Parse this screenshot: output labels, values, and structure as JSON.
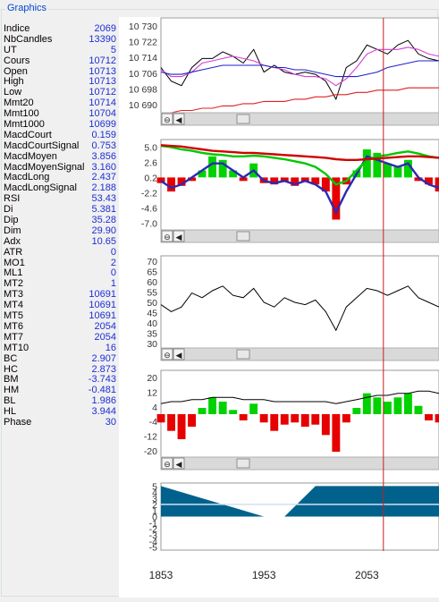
{
  "group_title": "Graphics",
  "indicators": [
    {
      "name": "Indice",
      "value": "2069"
    },
    {
      "name": "NbCandles",
      "value": "13390"
    },
    {
      "name": "UT",
      "value": "5"
    },
    {
      "name": "Cours",
      "value": "10712"
    },
    {
      "name": "Open",
      "value": "10713"
    },
    {
      "name": "High",
      "value": "10713"
    },
    {
      "name": "Low",
      "value": "10712"
    },
    {
      "name": "Mmt20",
      "value": "10714"
    },
    {
      "name": "Mmt100",
      "value": "10704"
    },
    {
      "name": "Mmt1000",
      "value": "10699"
    },
    {
      "name": "MacdCourt",
      "value": "0.159"
    },
    {
      "name": "MacdCourtSignal",
      "value": "0.753"
    },
    {
      "name": "MacdMoyen",
      "value": "3.856"
    },
    {
      "name": "MacdMoyenSignal",
      "value": "3.160"
    },
    {
      "name": "MacdLong",
      "value": "2.437"
    },
    {
      "name": "MacdLongSignal",
      "value": "2.188"
    },
    {
      "name": "RSI",
      "value": "53.43"
    },
    {
      "name": "Di",
      "value": "5.381"
    },
    {
      "name": "Dip",
      "value": "35.28"
    },
    {
      "name": "Dim",
      "value": "29.90"
    },
    {
      "name": "Adx",
      "value": "10.65"
    },
    {
      "name": "ATR",
      "value": "0"
    },
    {
      "name": "MO1",
      "value": "2"
    },
    {
      "name": "ML1",
      "value": "0"
    },
    {
      "name": "MT2",
      "value": "1"
    },
    {
      "name": "MT3",
      "value": "10691"
    },
    {
      "name": "MT4",
      "value": "10691"
    },
    {
      "name": "MT5",
      "value": "10691"
    },
    {
      "name": "MT6",
      "value": "2054"
    },
    {
      "name": "MT7",
      "value": "2054"
    },
    {
      "name": "MT10",
      "value": "16"
    },
    {
      "name": "BC",
      "value": "2.907"
    },
    {
      "name": "HC",
      "value": "2.873"
    },
    {
      "name": "BM",
      "value": "-3.743"
    },
    {
      "name": "HM",
      "value": "-0.481"
    },
    {
      "name": "BL",
      "value": "1.986"
    },
    {
      "name": "HL",
      "value": "3.944"
    },
    {
      "name": "Phase",
      "value": "30"
    }
  ],
  "colors": {
    "price": "#000000",
    "mmt20": "#d63cd6",
    "mmt100": "#2020c8",
    "mmt1000": "#e02020",
    "cursor": "#c81e1e",
    "macd_pos": "#00d200",
    "macd_neg": "#e60000",
    "macd_fast": "#2a2ab4",
    "macd_mid": "#00c800",
    "macd_long": "#d00000",
    "rsi": "#000000",
    "phase_fill": "#00628c",
    "phase_line": "#d2e0f0",
    "label": "#333333"
  },
  "scroll_buttons": {
    "zoom": "⊖",
    "left": "◀"
  },
  "x_axis": {
    "ticks": [
      "1853",
      "1953",
      "2053"
    ]
  },
  "cursor_index": 2069,
  "chart_data": [
    {
      "type": "line",
      "panel": "price",
      "yticks": [
        "10 730",
        "10 722",
        "10 714",
        "10 706",
        "10 698",
        "10 690"
      ],
      "ylim": [
        10688,
        10730
      ],
      "x": [
        1853,
        1863,
        1873,
        1883,
        1893,
        1903,
        1913,
        1923,
        1933,
        1943,
        1953,
        1963,
        1973,
        1983,
        1993,
        2003,
        2013,
        2023,
        2033,
        2043,
        2053,
        2063,
        2073,
        2083,
        2093,
        2103,
        2113,
        2123
      ],
      "series": [
        {
          "role": "price",
          "values": [
            10708,
            10702,
            10700,
            10708,
            10712,
            10712,
            10715,
            10713,
            10710,
            10716,
            10706,
            10709,
            10706,
            10705,
            10706,
            10705,
            10702,
            10694,
            10708,
            10711,
            10718,
            10716,
            10714,
            10718,
            10720,
            10714,
            10712,
            10711
          ]
        },
        {
          "role": "mmt20",
          "values": [
            10707,
            10704,
            10704,
            10706,
            10710,
            10711,
            10712,
            10713,
            10712,
            10711,
            10709,
            10708,
            10707,
            10705,
            10704,
            10704,
            10703,
            10700,
            10703,
            10708,
            10714,
            10716,
            10716,
            10716,
            10717,
            10716,
            10714,
            10713
          ]
        },
        {
          "role": "mmt100",
          "values": [
            10706,
            10705,
            10705,
            10706,
            10707,
            10708,
            10709,
            10709,
            10709,
            10709,
            10709,
            10708,
            10708,
            10707,
            10707,
            10706,
            10705,
            10704,
            10704,
            10704,
            10705,
            10706,
            10708,
            10709,
            10710,
            10711,
            10711,
            10711
          ]
        },
        {
          "role": "mmt1000",
          "values": [
            10687,
            10688,
            10689,
            10689,
            10690,
            10690,
            10691,
            10691,
            10692,
            10692,
            10693,
            10693,
            10693,
            10694,
            10694,
            10695,
            10695,
            10696,
            10696,
            10697,
            10697,
            10698,
            10698,
            10698,
            10699,
            10699,
            10699,
            10699
          ]
        }
      ]
    },
    {
      "type": "area",
      "panel": "macd",
      "yticks": [
        "5.0",
        "2.6",
        "0.2",
        "-2.2",
        "-4.6",
        "-7.0"
      ],
      "ylim": [
        -7.6,
        5.4
      ],
      "x": [
        1853,
        1863,
        1873,
        1883,
        1893,
        1903,
        1913,
        1923,
        1933,
        1943,
        1953,
        1963,
        1973,
        1983,
        1993,
        2003,
        2013,
        2023,
        2033,
        2043,
        2053,
        2063,
        2073,
        2083,
        2093,
        2103,
        2113,
        2123
      ],
      "series": [
        {
          "role": "histogram",
          "values": [
            -0.8,
            -2.0,
            -1.2,
            -0.5,
            1.0,
            3.0,
            2.5,
            1.0,
            -0.5,
            2.0,
            -0.8,
            -1.0,
            -0.6,
            -1.2,
            -0.6,
            -1.0,
            -2.0,
            -6.0,
            -1.0,
            1.0,
            4.0,
            3.5,
            2.0,
            1.5,
            2.5,
            -0.5,
            -1.0,
            -2.0
          ]
        },
        {
          "role": "fast",
          "values": [
            -0.5,
            -1.5,
            -1.0,
            0.0,
            1.0,
            2.0,
            2.0,
            1.0,
            0.0,
            1.0,
            -0.5,
            -0.8,
            -0.5,
            -1.0,
            -0.5,
            -1.0,
            -2.0,
            -5.0,
            -2.0,
            0.5,
            3.0,
            2.5,
            2.0,
            1.5,
            2.0,
            0.0,
            -1.0,
            -1.5
          ]
        },
        {
          "role": "mid",
          "values": [
            4.5,
            4.3,
            4.0,
            3.8,
            3.5,
            3.3,
            3.2,
            3.0,
            3.0,
            3.1,
            3.0,
            2.8,
            2.6,
            2.3,
            2.0,
            1.5,
            0.5,
            -1.0,
            -0.5,
            1.0,
            2.5,
            3.0,
            3.2,
            3.5,
            3.7,
            3.4,
            3.0,
            2.8
          ]
        },
        {
          "role": "long",
          "values": [
            4.6,
            4.5,
            4.4,
            4.2,
            4.0,
            3.8,
            3.7,
            3.6,
            3.5,
            3.5,
            3.4,
            3.3,
            3.2,
            3.1,
            3.0,
            2.9,
            2.8,
            2.6,
            2.5,
            2.5,
            2.6,
            2.7,
            2.8,
            2.9,
            3.0,
            3.0,
            2.9,
            2.8
          ]
        }
      ]
    },
    {
      "type": "line",
      "panel": "rsi",
      "yticks": [
        "70",
        "65",
        "60",
        "55",
        "50",
        "45",
        "40",
        "35",
        "30"
      ],
      "ylim": [
        30,
        70
      ],
      "x": [
        1853,
        1863,
        1873,
        1883,
        1893,
        1903,
        1913,
        1923,
        1933,
        1943,
        1953,
        1963,
        1973,
        1983,
        1993,
        2003,
        2013,
        2023,
        2033,
        2043,
        2053,
        2063,
        2073,
        2083,
        2093,
        2103,
        2113,
        2123
      ],
      "series": [
        {
          "role": "rsi",
          "values": [
            49,
            46,
            48,
            54,
            52,
            55,
            57,
            53,
            52,
            56,
            50,
            48,
            52,
            50,
            49,
            51,
            46,
            38,
            48,
            52,
            56,
            55,
            53,
            55,
            57,
            52,
            50,
            48
          ]
        }
      ]
    },
    {
      "type": "bar",
      "panel": "strength",
      "yticks": [
        "20",
        "12",
        "4",
        "-4",
        "-12",
        "-20"
      ],
      "ylim": [
        -21,
        21
      ],
      "x": [
        1853,
        1863,
        1873,
        1883,
        1893,
        1903,
        1913,
        1923,
        1933,
        1943,
        1953,
        1963,
        1973,
        1983,
        1993,
        2003,
        2013,
        2023,
        2033,
        2043,
        2053,
        2063,
        2073,
        2083,
        2093,
        2103,
        2113,
        2123
      ],
      "series": [
        {
          "role": "histogram",
          "values": [
            -4,
            -8,
            -12,
            -6,
            3,
            8,
            6,
            2,
            -3,
            5,
            -4,
            -8,
            -5,
            -4,
            -6,
            -5,
            -10,
            -18,
            -4,
            3,
            10,
            8,
            6,
            8,
            10,
            4,
            -3,
            -4
          ]
        },
        {
          "role": "smooth",
          "values": [
            5,
            6,
            6,
            7,
            7,
            8,
            8,
            8,
            7,
            7,
            7,
            6,
            6,
            6,
            6,
            6,
            6,
            5,
            6,
            7,
            8,
            9,
            9,
            10,
            10,
            11,
            11,
            10
          ]
        }
      ]
    },
    {
      "type": "area",
      "panel": "phase",
      "yticks": [
        "5",
        "4",
        "3",
        "2",
        "1",
        "0",
        "-1",
        "-2",
        "-3",
        "-4",
        "-5"
      ],
      "ylim": [
        -5.5,
        5.5
      ],
      "x": [
        1853,
        1953,
        1973,
        2003,
        2123
      ],
      "series": [
        {
          "role": "phase",
          "values": [
            5,
            0,
            0,
            5,
            5
          ]
        }
      ]
    }
  ]
}
